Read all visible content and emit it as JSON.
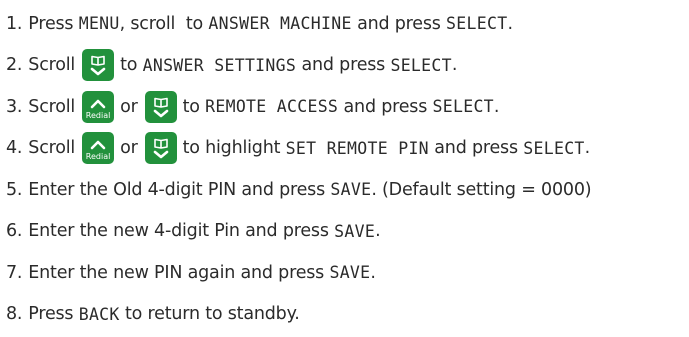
{
  "steps": [
    {
      "num": "1.",
      "t1": "Press ",
      "c1": "MENU",
      "t2": ", scroll  to ",
      "c2": "ANSWER MACHINE",
      "t3": " and press ",
      "c3": "SELECT",
      "t4": "."
    },
    {
      "num": "2.",
      "t1": "Scroll",
      "t2": "to ",
      "c2": "ANSWER SETTINGS",
      "t3": " and press ",
      "c3": "SELECT",
      "t4": "."
    },
    {
      "num": "3.",
      "t1": "Scroll",
      "or": "or",
      "t2": "to ",
      "c2": "REMOTE ACCESS",
      "t3": " and press ",
      "c3": "SELECT",
      "t4": "."
    },
    {
      "num": "4.",
      "t1": "Scroll",
      "or": "or",
      "t2": "to highlight ",
      "c2": "SET REMOTE PIN",
      "t3": " and press ",
      "c3": "SELECT",
      "t4": "."
    },
    {
      "num": "5.",
      "t1": "Enter the Old 4-digit PIN and press ",
      "c1": "SAVE",
      "t2": ". (Default setting = 0000)"
    },
    {
      "num": "6.",
      "t1": "Enter the new 4-digit Pin and press ",
      "c1": "SAVE",
      "t2": "."
    },
    {
      "num": "7.",
      "t1": "Enter the new PIN again and press ",
      "c1": "SAVE",
      "t2": "."
    },
    {
      "num": "8.",
      "t1": "Press ",
      "c1": "BACK",
      "t2": " to return to standby."
    }
  ],
  "icons": {
    "redial_key_label": "Redial",
    "key_color": "#22913c"
  }
}
